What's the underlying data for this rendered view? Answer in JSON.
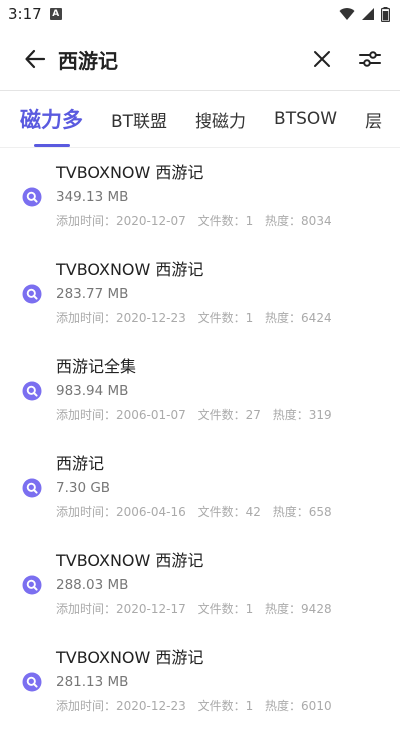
{
  "status": {
    "time": "3:17",
    "notification_badge": "A"
  },
  "search": {
    "query": "西游记"
  },
  "tabs": [
    {
      "label": "磁力多",
      "active": true
    },
    {
      "label": "BT联盟",
      "active": false
    },
    {
      "label": "搜磁力",
      "active": false
    },
    {
      "label": "BTSOW",
      "active": false
    },
    {
      "label": "层",
      "active": false
    }
  ],
  "results": [
    {
      "title": "TVBOXNOW 西游记",
      "size": "349.13 MB",
      "added": "添加时间：2020-12-07",
      "files": "文件数：1",
      "heat": "热度：8034"
    },
    {
      "title": "TVBOXNOW 西游记",
      "size": "283.77 MB",
      "added": "添加时间：2020-12-23",
      "files": "文件数：1",
      "heat": "热度：6424"
    },
    {
      "title": "西游记全集",
      "size": "983.94 MB",
      "added": "添加时间：2006-01-07",
      "files": "文件数：27",
      "heat": "热度：319"
    },
    {
      "title": "西游记",
      "size": "7.30 GB",
      "added": "添加时间：2006-04-16",
      "files": "文件数：42",
      "heat": "热度：658"
    },
    {
      "title": "TVBOXNOW 西游记",
      "size": "288.03 MB",
      "added": "添加时间：2020-12-17",
      "files": "文件数：1",
      "heat": "热度：9428"
    },
    {
      "title": "TVBOXNOW 西游记",
      "size": "281.13 MB",
      "added": "添加时间：2020-12-23",
      "files": "文件数：1",
      "heat": "热度：6010"
    }
  ],
  "colors": {
    "accent": "#5a5adf",
    "icon": "#7b6ff0"
  },
  "icons": {
    "back": "arrow-left-icon",
    "clear": "close-icon",
    "filter": "sliders-icon",
    "result": "magnet-search-icon"
  }
}
